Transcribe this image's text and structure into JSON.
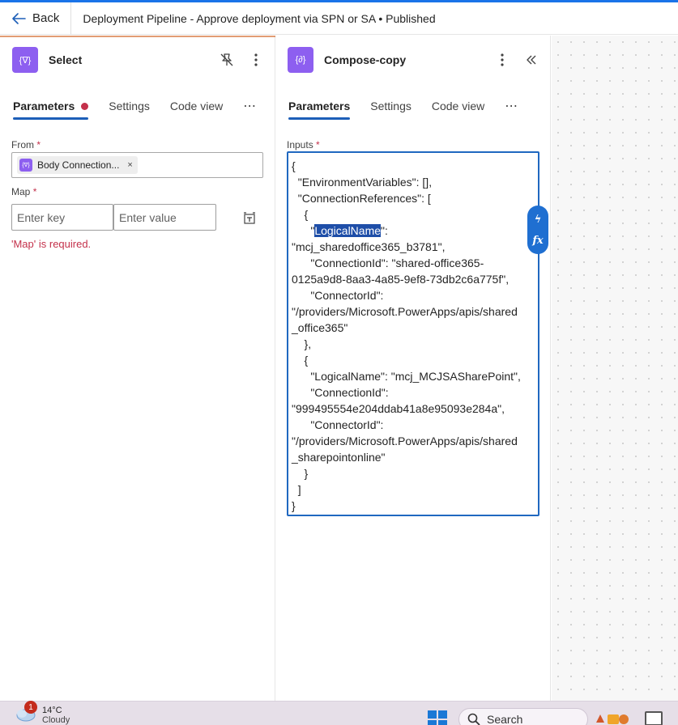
{
  "header": {
    "back_label": "Back",
    "title": "Deployment Pipeline - Approve deployment via SPN or SA • Published"
  },
  "left_panel": {
    "action_icon_text": "{∇}",
    "action_name": "Select",
    "tabs": [
      "Parameters",
      "Settings",
      "Code view"
    ],
    "more_tabs": "⋯",
    "from_label": "From",
    "from_token": "Body Connection...",
    "from_token_remove": "×",
    "map_label": "Map",
    "required_marker": "*",
    "map_key_placeholder": "Enter key",
    "map_value_placeholder": "Enter value",
    "error_text": "'Map' is required."
  },
  "right_panel": {
    "action_icon_text": "{∂}",
    "action_name": "Compose-copy",
    "tabs": [
      "Parameters",
      "Settings",
      "Code view"
    ],
    "more_tabs": "⋯",
    "inputs_label": "Inputs",
    "required_marker": "*",
    "code_lines": [
      "{",
      "  \"EnvironmentVariables\": [],",
      "  \"ConnectionReferences\": [",
      "    {",
      "      \"",
      "LogicalName",
      "\":",
      "\"mcj_sharedoffice365_b3781\",",
      "      \"ConnectionId\": \"shared-office365-",
      "0125a9d8-8aa3-4a85-9ef8-73db2c6a775f\",",
      "      \"ConnectorId\":",
      "\"/providers/Microsoft.PowerApps/apis/shared",
      "_office365\"",
      "    },",
      "    {",
      "      \"LogicalName\": \"mcj_MCJSASharePoint\",",
      "      \"ConnectionId\":",
      "\"999495554e204ddab41a8e95093e284a\",",
      "      \"ConnectorId\":",
      "\"/providers/Microsoft.PowerApps/apis/shared",
      "_sharepointonline\"",
      "    }",
      "  ]",
      "}"
    ],
    "side_tools": [
      "ϟ",
      "fx"
    ]
  },
  "taskbar": {
    "notification_count": "1",
    "temperature": "14°C",
    "condition": "Cloudy",
    "search_label": "Search"
  },
  "colors": {
    "accent_blue": "#1d5fb8",
    "action_purple": "#8d5ff0",
    "error_red": "#c4314b",
    "highlight": "#1e4ea8"
  }
}
